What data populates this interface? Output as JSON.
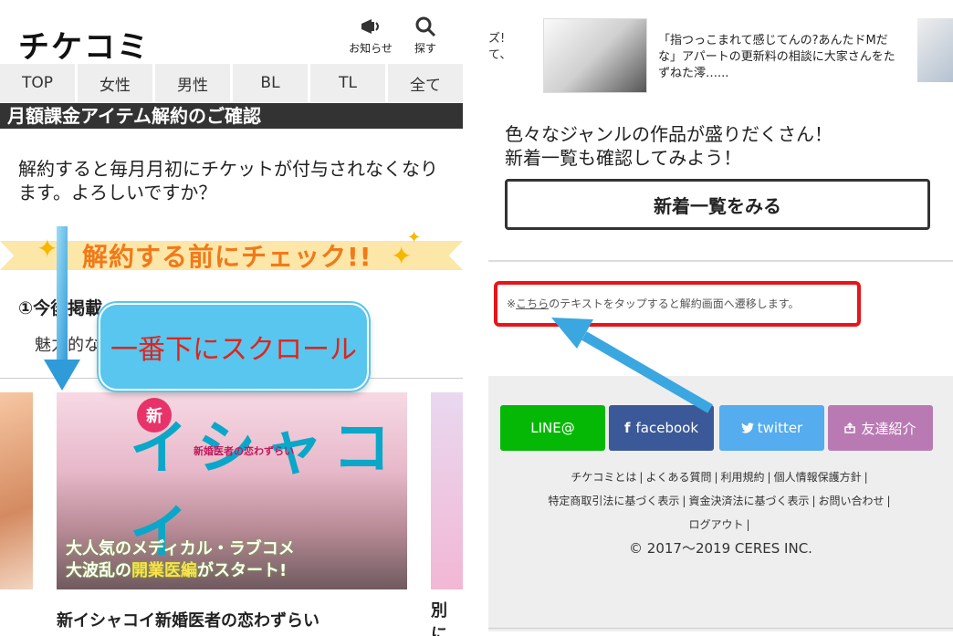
{
  "left": {
    "logo": "チケコミ",
    "header_buttons": [
      {
        "label": "お知らせ",
        "icon": "megaphone-icon"
      },
      {
        "label": "探す",
        "icon": "search-icon"
      }
    ],
    "nav": [
      "TOP",
      "女性",
      "男性",
      "BL",
      "TL",
      "全て"
    ],
    "title_bar": "月額課金アイテム解約のご確認",
    "confirm_text": "解約すると毎月月初にチケットが付与されなくなります。よろしいですか？",
    "check_banner": "解約する前にチェック!!",
    "item_title": "①今後掲載",
    "item_desc": "魅力的な",
    "cover": {
      "new_badge": "新",
      "logo": "イシャコイ",
      "subtitle": "新婚医者の恋わずらい",
      "copy_line1": "大人気のメディカル・ラブコメ",
      "copy_line2_a": "大波乱の",
      "copy_line2_hl": "開業医編",
      "copy_line2_b": "がスタート!"
    },
    "side_title": "別に",
    "bottom_title": "新イシャコイ新婚医者の恋わずらい",
    "scroll_bubble": "一番下にスクロール"
  },
  "right": {
    "prev_text": "ズ!\nて、",
    "article_text": "「指つっこまれて感じてんの?あんたドMだな」アパートの更新料の相談に大家さんをたずねた澪…...",
    "genre_text_1": "色々なジャンルの作品が盛りだくさん！",
    "genre_text_2": "新着一覧も確認してみよう！",
    "new_button": "新着一覧をみる",
    "cancel_prefix": "※",
    "cancel_link": "こちら",
    "cancel_suffix": "のテキストをタップすると解約画面へ遷移します。",
    "social": [
      {
        "label": "LINE@",
        "icon": ""
      },
      {
        "label": "facebook",
        "icon": "facebook-icon"
      },
      {
        "label": "twitter",
        "icon": "twitter-icon"
      },
      {
        "label": "友達紹介",
        "icon": "share-icon"
      }
    ],
    "footer_links_row1": [
      "チケコミとは",
      "よくある質問",
      "利用規約",
      "個人情報保護方針"
    ],
    "footer_links_row2": [
      "特定商取引法に基づく表示",
      "資金決済法に基づく表示",
      "お問い合わせ"
    ],
    "footer_links_row3": [
      "ログアウト"
    ],
    "copyright": "© 2017〜2019 CERES INC."
  },
  "colors": {
    "accent_orange": "#f07a1a",
    "highlight_red": "#e8141a",
    "arrow_blue": "#3aa7e0",
    "line_green": "#06b806",
    "facebook_blue": "#3b5998",
    "twitter_blue": "#55acee",
    "friend_purple": "#b97ab3"
  }
}
